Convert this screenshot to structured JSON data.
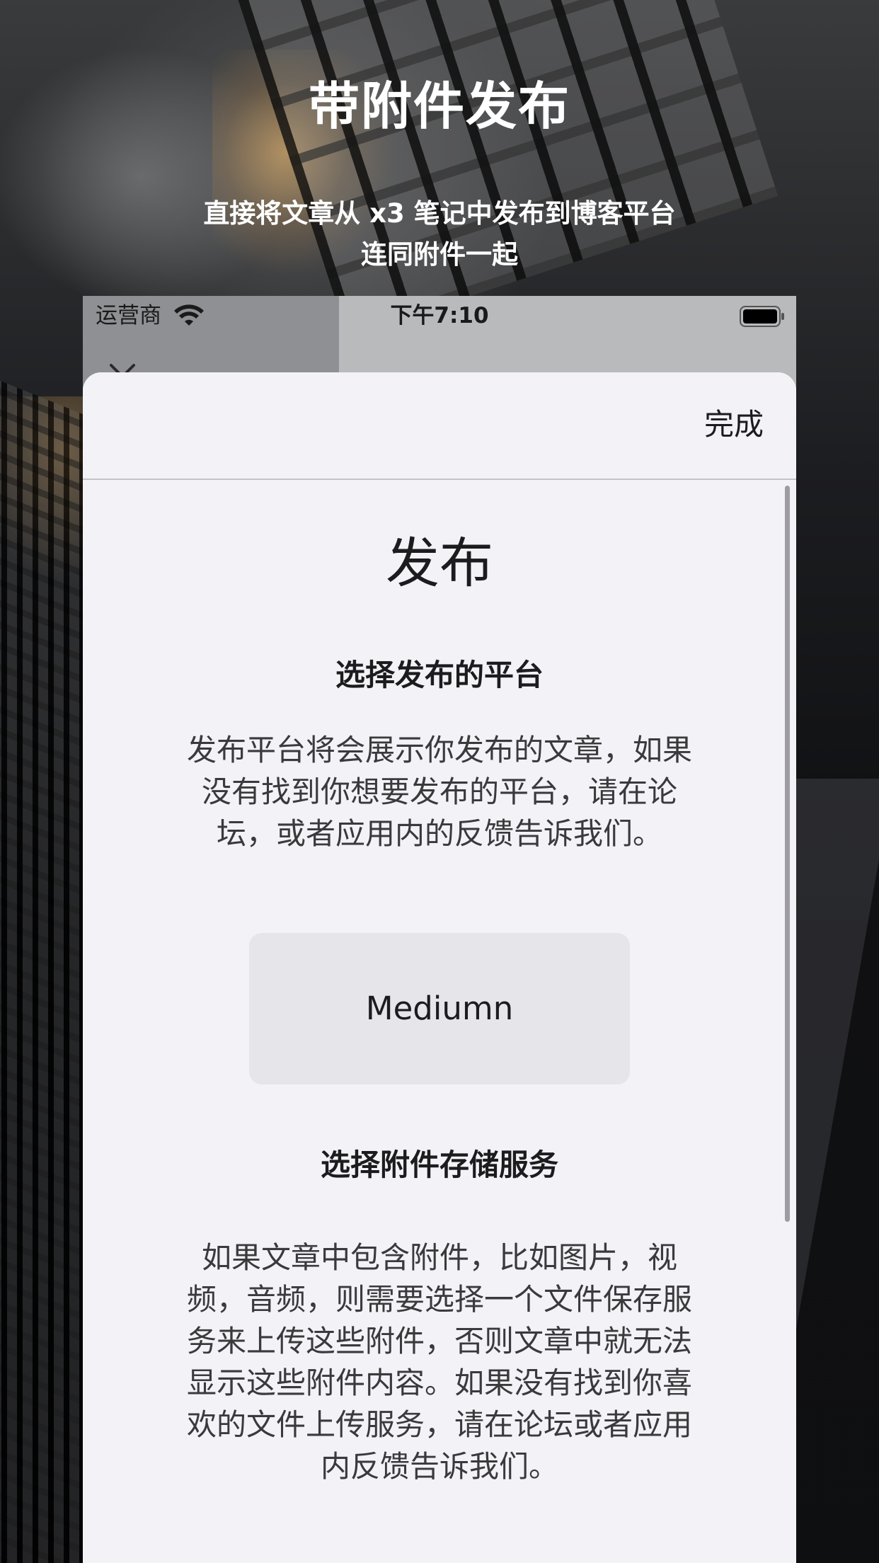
{
  "promo": {
    "headline": "带附件发布",
    "subhead_line1": "直接将文章从 x3 笔记中发布到博客平台",
    "subhead_line2": "连同附件一起"
  },
  "status_bar": {
    "carrier": "运营商",
    "time": "下午7:10"
  },
  "sheet": {
    "done_label": "完成",
    "title": "发布",
    "platform_section": {
      "title": "选择发布的平台",
      "description": "发布平台将会展示你发布的文章，如果没有找到你想要发布的平台，请在论坛，或者应用内的反馈告诉我们。",
      "platform_label": "Mediumn"
    },
    "storage_section": {
      "title": "选择附件存储服务",
      "description": "如果文章中包含附件，比如图片，视频，音频，则需要选择一个文件保存服务来上传这些附件，否则文章中就无法显示这些附件内容。如果没有找到你喜欢的文件上传服务，请在论坛或者应用内反馈告诉我们。"
    }
  },
  "colors": {
    "sheet_background": "#f2f2f7",
    "button_background": "#e5e5ea",
    "text_primary": "#1c1c1e",
    "text_secondary": "#3a3a3c"
  },
  "icons": {
    "wifi": "wifi-icon",
    "battery": "battery-icon",
    "close": "close-icon",
    "more": "more-icon",
    "next": "chevron-right-icon"
  }
}
